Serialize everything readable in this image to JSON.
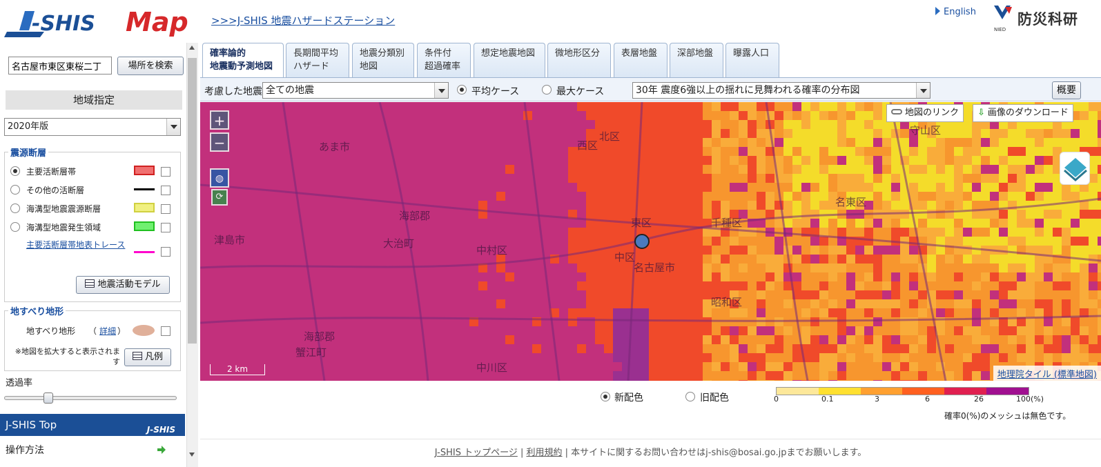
{
  "header": {
    "logo_text": "J-SHIS Map",
    "top_link": ">>>J-SHIS 地震ハザードステーション",
    "english": "English",
    "nied_name": "防災科研",
    "nied_sub": "NIED"
  },
  "sidebar": {
    "search_value": "名古屋市東区東桜二丁",
    "search_button": "場所を検索",
    "region_title": "地域指定",
    "year_select": "2020年版",
    "fault_section": {
      "title": "震源断層",
      "items": [
        {
          "label": "主要活断層帯",
          "selected": true,
          "swatch": "#f07070"
        },
        {
          "label": "その他の活断層",
          "selected": false,
          "swatch": "#000000"
        },
        {
          "label": "海溝型地震震源断層",
          "selected": false,
          "swatch": "#f0f080"
        },
        {
          "label": "海溝型地震発生領域",
          "selected": false,
          "swatch": "#70f070"
        }
      ],
      "trace_link": "主要活断層帯地表トレース",
      "trace_color": "#ff00cc",
      "model_button": "地震活動モデル"
    },
    "landslide_section": {
      "title": "地すべり地形",
      "label": "地すべり地形",
      "paren_open": "（",
      "detail_link": "詳細",
      "paren_close": "）",
      "swatch": "#e0b09a",
      "note": "※地図を拡大すると表示されます",
      "legend_button": "凡例"
    },
    "transparency_label": "透過率",
    "transparency_value": 0.24,
    "jshis_top": "J-SHIS Top",
    "jshis_top_badge": "J-SHIS",
    "operation": "操作方法"
  },
  "tabs": [
    {
      "line1": "確率論的",
      "line2": "地震動予測地図",
      "active": true
    },
    {
      "line1": "長期間平均",
      "line2": "ハザード"
    },
    {
      "line1": "地震分類別",
      "line2": "地図"
    },
    {
      "line1": "条件付",
      "line2": "超過確率"
    },
    {
      "line1": "想定地震地図",
      "line2": ""
    },
    {
      "line1": "微地形区分",
      "line2": ""
    },
    {
      "line1": "表層地盤",
      "line2": ""
    },
    {
      "line1": "深部地盤",
      "line2": ""
    },
    {
      "line1": "曝露人口",
      "line2": ""
    }
  ],
  "toolbar": {
    "quake_label": "考慮した地震",
    "quake_value": "全ての地震",
    "case_avg": "平均ケース",
    "case_max": "最大ケース",
    "map_value": "30年 震度6強以上の揺れに見舞われる確率の分布図",
    "summary": "概要"
  },
  "map": {
    "link_button": "地図のリンク",
    "download_button": "画像のダウンロード",
    "zoom_in": "+",
    "zoom_out": "−",
    "scale": "2 km",
    "tile_link": "地理院タイル (標準地図)",
    "labels": [
      {
        "text": "あま市"
      },
      {
        "text": "海部郡"
      },
      {
        "text": "大治町"
      },
      {
        "text": "津島市"
      },
      {
        "text": "中村区"
      },
      {
        "text": "中川区"
      },
      {
        "text": "海部郡"
      },
      {
        "text": "蟹江町"
      },
      {
        "text": "西区"
      },
      {
        "text": "北区"
      },
      {
        "text": "東区"
      },
      {
        "text": "中区"
      },
      {
        "text": "名古屋市"
      },
      {
        "text": "昭和区"
      },
      {
        "text": "千種区"
      },
      {
        "text": "名東区"
      },
      {
        "text": "守山区"
      }
    ]
  },
  "legend": {
    "new_color": "新配色",
    "old_color": "旧配色",
    "colors": [
      "#fde89a",
      "#ffe030",
      "#ffa030",
      "#ff6020",
      "#e02050",
      "#a01090"
    ],
    "ticks": [
      "0",
      "0.1",
      "3",
      "6",
      "26",
      "100(%)"
    ],
    "note": "確率0(%)のメッシュは無色です。"
  },
  "footer": {
    "top_page": "J-SHIS トップページ",
    "sep": " | ",
    "terms": "利用規約",
    "contact": " | 本サイトに関するお問い合わせはj-shis@bosai.go.jpまでお願いします。"
  }
}
